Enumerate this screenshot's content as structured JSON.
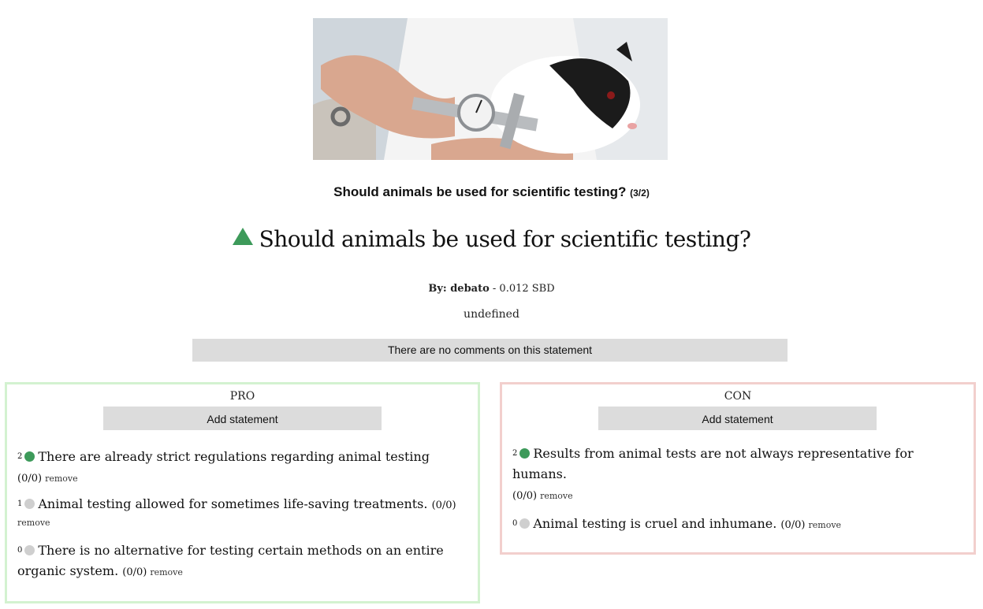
{
  "hero_image": {
    "alt": ""
  },
  "topic": {
    "title": "Should animals be used for scientific testing?",
    "count": "(3/2)"
  },
  "statement": {
    "heading": "Should animals be used for scientific testing?"
  },
  "byline": {
    "prefix": "By: debato",
    "payout": " - 0.012 SBD"
  },
  "description": "undefined",
  "comments": {
    "empty_text": "There are no comments on this statement"
  },
  "pro": {
    "label": "PRO",
    "add_label": "Add statement",
    "items": [
      {
        "votes": "2",
        "status": "green",
        "text": "There are already strict regulations regarding animal testing",
        "score": "(0/0)",
        "remove": "remove"
      },
      {
        "votes": "1",
        "status": "grey",
        "text": "Animal testing allowed for sometimes life-saving treatments.",
        "score": "(0/0)",
        "remove": "remove"
      },
      {
        "votes": "0",
        "status": "grey",
        "text": "There is no alternative for testing certain methods on an entire organic system.",
        "score": "(0/0)",
        "remove": "remove"
      }
    ]
  },
  "con": {
    "label": "CON",
    "add_label": "Add statement",
    "items": [
      {
        "votes": "2",
        "status": "green",
        "text": "Results from animal tests are not always representative for humans.",
        "score": "(0/0)",
        "remove": "remove"
      },
      {
        "votes": "0",
        "status": "grey",
        "text": "Animal testing is cruel and inhumane.",
        "score": "(0/0)",
        "remove": "remove"
      }
    ]
  },
  "colors": {
    "accent_green": "#3d9a5a",
    "pro_border": "#d3f2d0",
    "con_border": "#f2cfcd",
    "button_bg": "#dcdcdc"
  }
}
